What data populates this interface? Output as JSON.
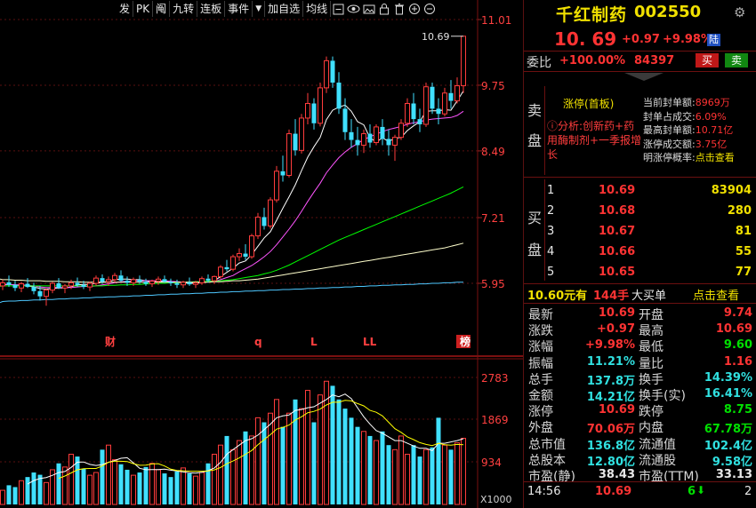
{
  "toolbar": {
    "buttons": [
      "发",
      "PK",
      "阄",
      "九转",
      "连板",
      "事件",
      "▼",
      "加自选",
      "均线"
    ],
    "icons": [
      "minus-box-icon",
      "eye-icon",
      "gallery-icon",
      "lock-icon",
      "trash-icon",
      "zoom-in-icon",
      "zoom-out-icon"
    ]
  },
  "stock": {
    "name": "千红制药",
    "code": "002550",
    "price": "10. 69",
    "change": "+0.97",
    "change_pct": "+9.98%",
    "market_badge": "陆",
    "weibi_label": "委比",
    "weibi_value": "+100.00%",
    "weibi_count": "84397",
    "buy_btn": "买",
    "sell_btn": "卖"
  },
  "limit_panel": {
    "sell_label_1": "卖",
    "sell_label_2": "盘",
    "title": "涨停(首板)",
    "analysis": "ⓘ分析:创新药+药用酶制剂+一季报增长",
    "stats": [
      {
        "k": "当前封单额:",
        "v": "8969万"
      },
      {
        "k": "封单占成交:",
        "v": "6.09%"
      },
      {
        "k": "最高封单额:",
        "v": "10.71亿"
      },
      {
        "k": "涨停成交额:",
        "v": "3.75亿"
      },
      {
        "k": "明涨停概率:",
        "v": "点击查看"
      }
    ]
  },
  "bid": {
    "label_1": "买",
    "label_2": "盘",
    "rows": [
      {
        "level": "1",
        "price": "10.69",
        "vol": "83904"
      },
      {
        "level": "2",
        "price": "10.68",
        "vol": "280"
      },
      {
        "level": "3",
        "price": "10.67",
        "vol": "81"
      },
      {
        "level": "4",
        "price": "10.66",
        "vol": "55"
      },
      {
        "level": "5",
        "price": "10.65",
        "vol": "77"
      }
    ]
  },
  "big_order": {
    "price": "10.60元有",
    "hands": "144手",
    "label": "大买单",
    "link": "点击查看"
  },
  "quote": {
    "rows": [
      {
        "l1": "最新",
        "v1": "10.69",
        "c1": "red",
        "l2": "开盘",
        "v2": "9.74",
        "c2": "red"
      },
      {
        "l1": "涨跌",
        "v1": "+0.97",
        "c1": "red",
        "l2": "最高",
        "v2": "10.69",
        "c2": "red"
      },
      {
        "l1": "涨幅",
        "v1": "+9.98%",
        "c1": "red",
        "l2": "最低",
        "v2": "9.60",
        "c2": "green"
      },
      {
        "l1": "振幅",
        "v1": "11.21%",
        "c1": "cyan",
        "l2": "量比",
        "v2": "1.16",
        "c2": "red"
      },
      {
        "l1": "总手",
        "v1": "137.8万",
        "c1": "cyan",
        "l2": "换手",
        "v2": "14.39%",
        "c2": "cyan"
      },
      {
        "l1": "金额",
        "v1": "14.21亿",
        "c1": "cyan",
        "l2": "换手(实)",
        "v2": "16.41%",
        "c2": "cyan"
      },
      {
        "l1": "涨停",
        "v1": "10.69",
        "c1": "red",
        "l2": "跌停",
        "v2": "8.75",
        "c2": "green"
      },
      {
        "l1": "外盘",
        "v1": "70.06万",
        "c1": "red",
        "l2": "内盘",
        "v2": "67.78万",
        "c2": "green"
      },
      {
        "l1": "总市值",
        "v1": "136.8亿",
        "c1": "cyan",
        "l2": "流通值",
        "v2": "102.4亿",
        "c2": "cyan"
      },
      {
        "l1": "总股本",
        "v1": "12.80亿",
        "c1": "cyan",
        "l2": "流通股",
        "v2": "9.58亿",
        "c2": "cyan"
      },
      {
        "l1": "市盈(静)",
        "v1": "38.43",
        "c1": "white",
        "l2": "市盈(TTM)",
        "v2": "33.13",
        "c2": "white"
      }
    ]
  },
  "last_trade": {
    "time": "14:56",
    "price": "10.69",
    "vol": "6",
    "count": "2"
  },
  "chart_data": {
    "type": "candlestick",
    "price_axis": [
      "11.01",
      "9.75",
      "8.49",
      "7.21",
      "5.95"
    ],
    "price_ticks": [
      11.01,
      9.75,
      8.49,
      7.21,
      5.95
    ],
    "volume_axis": [
      "2783",
      "1869",
      "934"
    ],
    "volume_ticks": [
      2783,
      1869,
      934
    ],
    "volume_unit": "X1000",
    "high_label": "10.69",
    "markers": [
      {
        "text": "财",
        "bar": 17,
        "boxed": false
      },
      {
        "text": "q",
        "bar": 41,
        "boxed": false
      },
      {
        "text": "L",
        "bar": 50,
        "boxed": false
      },
      {
        "text": "LL",
        "bar": 59,
        "boxed": false
      },
      {
        "text": "榜",
        "bar": 74,
        "boxed": true
      }
    ],
    "ohlc": [
      [
        5.9,
        6.02,
        5.82,
        5.96
      ],
      [
        5.97,
        6.1,
        5.88,
        5.92
      ],
      [
        5.92,
        6.0,
        5.8,
        5.86
      ],
      [
        5.86,
        5.98,
        5.78,
        5.94
      ],
      [
        5.94,
        6.05,
        5.86,
        5.88
      ],
      [
        5.88,
        5.96,
        5.74,
        5.8
      ],
      [
        5.8,
        5.9,
        5.62,
        5.7
      ],
      [
        5.7,
        5.85,
        5.52,
        5.82
      ],
      [
        5.82,
        5.98,
        5.76,
        5.95
      ],
      [
        5.95,
        6.05,
        5.84,
        5.86
      ],
      [
        5.86,
        5.94,
        5.76,
        5.9
      ],
      [
        5.9,
        6.02,
        5.84,
        5.96
      ],
      [
        5.96,
        6.06,
        5.88,
        5.92
      ],
      [
        5.92,
        6.0,
        5.84,
        5.88
      ],
      [
        5.88,
        5.98,
        5.8,
        5.95
      ],
      [
        5.95,
        6.1,
        5.9,
        6.05
      ],
      [
        6.05,
        6.12,
        5.94,
        5.98
      ],
      [
        5.98,
        6.08,
        5.9,
        6.02
      ],
      [
        6.02,
        6.15,
        5.96,
        6.1
      ],
      [
        6.1,
        6.2,
        5.98,
        6.0
      ],
      [
        6.0,
        6.08,
        5.9,
        5.96
      ],
      [
        5.96,
        6.06,
        5.9,
        6.02
      ],
      [
        6.02,
        6.1,
        5.94,
        5.98
      ],
      [
        5.98,
        6.04,
        5.9,
        5.94
      ],
      [
        5.94,
        6.02,
        5.88,
        5.99
      ],
      [
        5.99,
        6.08,
        5.92,
        6.03
      ],
      [
        6.03,
        6.1,
        5.96,
        5.98
      ],
      [
        5.98,
        6.04,
        5.9,
        5.95
      ],
      [
        5.95,
        6.02,
        5.86,
        5.92
      ],
      [
        5.92,
        6.0,
        5.86,
        5.97
      ],
      [
        5.97,
        6.06,
        5.9,
        5.93
      ],
      [
        5.93,
        6.0,
        5.86,
        5.96
      ],
      [
        5.96,
        6.08,
        5.92,
        6.04
      ],
      [
        6.04,
        6.12,
        5.96,
        6.0
      ],
      [
        6.0,
        6.1,
        5.94,
        6.08
      ],
      [
        6.08,
        6.3,
        6.04,
        6.26
      ],
      [
        6.26,
        6.4,
        6.18,
        6.22
      ],
      [
        6.22,
        6.5,
        6.18,
        6.46
      ],
      [
        6.46,
        6.62,
        6.38,
        6.52
      ],
      [
        6.52,
        6.7,
        6.4,
        6.46
      ],
      [
        6.46,
        6.9,
        6.42,
        6.86
      ],
      [
        6.86,
        7.3,
        6.8,
        7.22
      ],
      [
        7.22,
        7.4,
        6.98,
        7.05
      ],
      [
        7.05,
        7.6,
        7.0,
        7.55
      ],
      [
        7.55,
        8.2,
        7.5,
        8.1
      ],
      [
        8.1,
        8.4,
        7.9,
        8.02
      ],
      [
        8.02,
        8.9,
        7.98,
        8.82
      ],
      [
        8.82,
        9.1,
        8.4,
        8.5
      ],
      [
        8.5,
        9.2,
        8.44,
        9.12
      ],
      [
        9.12,
        9.6,
        9.0,
        9.4
      ],
      [
        9.4,
        9.5,
        8.9,
        9.02
      ],
      [
        9.02,
        9.8,
        8.96,
        9.7
      ],
      [
        9.7,
        10.3,
        9.6,
        10.22
      ],
      [
        10.22,
        10.3,
        9.7,
        9.8
      ],
      [
        9.8,
        10.0,
        9.2,
        9.3
      ],
      [
        9.3,
        9.5,
        8.7,
        8.85
      ],
      [
        8.85,
        9.1,
        8.55,
        8.7
      ],
      [
        8.7,
        8.95,
        8.4,
        8.6
      ],
      [
        8.6,
        8.9,
        8.45,
        8.82
      ],
      [
        8.82,
        9.0,
        8.55,
        8.65
      ],
      [
        8.65,
        9.0,
        8.6,
        8.95
      ],
      [
        8.95,
        9.1,
        8.6,
        8.72
      ],
      [
        8.72,
        8.9,
        8.4,
        8.6
      ],
      [
        8.6,
        8.8,
        8.3,
        8.75
      ],
      [
        8.75,
        9.1,
        8.7,
        9.02
      ],
      [
        9.02,
        9.5,
        8.95,
        9.4
      ],
      [
        9.4,
        9.6,
        9.0,
        9.1
      ],
      [
        9.1,
        9.3,
        8.85,
        9.0
      ],
      [
        9.0,
        9.8,
        8.95,
        9.72
      ],
      [
        9.72,
        9.8,
        9.2,
        9.3
      ],
      [
        9.3,
        9.5,
        9.0,
        9.2
      ],
      [
        9.2,
        9.7,
        9.15,
        9.6
      ],
      [
        9.6,
        9.85,
        9.3,
        9.45
      ],
      [
        9.45,
        9.9,
        9.4,
        9.74
      ],
      [
        9.74,
        10.69,
        9.6,
        10.69
      ]
    ],
    "volume": [
      310,
      420,
      380,
      520,
      600,
      700,
      650,
      480,
      760,
      900,
      820,
      1100,
      1050,
      780,
      640,
      700,
      1200,
      1300,
      980,
      880,
      760,
      640,
      700,
      820,
      900,
      760,
      680,
      600,
      720,
      800,
      680,
      620,
      700,
      900,
      1100,
      1300,
      1500,
      1200,
      1400,
      1600,
      1500,
      1900,
      1800,
      2000,
      2300,
      1700,
      2000,
      2300,
      2100,
      2500,
      1800,
      2400,
      2700,
      2600,
      2300,
      2100,
      1900,
      1700,
      1600,
      1500,
      1400,
      1600,
      1300,
      1200,
      1500,
      1100,
      1300,
      1050,
      1200,
      1250,
      1900,
      1300,
      1200,
      1350,
      1450
    ],
    "ma_price": [
      {
        "color": "#ffffff",
        "values_from": 0,
        "data": [
          5.92,
          5.93,
          5.92,
          5.91,
          5.9,
          5.88,
          5.85,
          5.84,
          5.85,
          5.86,
          5.86,
          5.88,
          5.92,
          5.93,
          5.93,
          5.95,
          5.97,
          5.98,
          6.02,
          6.03,
          6.03,
          6.02,
          6.02,
          6.0,
          5.98,
          5.98,
          5.99,
          5.99,
          5.97,
          5.96,
          5.95,
          5.95,
          5.96,
          5.98,
          6.0,
          6.08,
          6.16,
          6.24,
          6.34,
          6.38,
          6.5,
          6.66,
          6.82,
          6.94,
          7.16,
          7.39,
          7.61,
          7.84,
          8.11,
          8.37,
          8.57,
          8.75,
          9.09,
          9.27,
          9.33,
          9.37,
          9.25,
          9.05,
          8.99,
          8.74,
          8.66,
          8.74,
          8.67,
          8.73,
          8.75,
          8.88,
          8.97,
          9.05,
          9.25,
          9.26,
          9.26,
          9.28,
          9.27,
          9.45,
          9.64
        ]
      },
      {
        "color": "#ff55ff",
        "values_from": 0,
        "data": [
          5.93,
          5.93,
          5.92,
          5.92,
          5.91,
          5.9,
          5.88,
          5.87,
          5.87,
          5.87,
          5.87,
          5.87,
          5.88,
          5.89,
          5.89,
          5.9,
          5.92,
          5.94,
          5.96,
          5.98,
          5.99,
          6.0,
          6.0,
          6.0,
          6.0,
          6.0,
          6.0,
          5.99,
          5.98,
          5.97,
          5.97,
          5.97,
          5.97,
          5.98,
          5.99,
          6.02,
          6.06,
          6.1,
          6.17,
          6.23,
          6.29,
          6.37,
          6.46,
          6.56,
          6.69,
          6.84,
          6.99,
          7.15,
          7.33,
          7.52,
          7.7,
          7.87,
          8.07,
          8.22,
          8.36,
          8.47,
          8.56,
          8.63,
          8.71,
          8.76,
          8.81,
          8.86,
          8.9,
          8.93,
          8.96,
          9.0,
          9.03,
          9.05,
          9.08,
          9.1,
          9.11,
          9.12,
          9.13,
          9.17,
          9.25
        ]
      },
      {
        "color": "#00ff00",
        "values_from": 0,
        "data": [
          5.9,
          5.9,
          5.9,
          5.9,
          5.9,
          5.9,
          5.9,
          5.9,
          5.9,
          5.9,
          5.9,
          5.9,
          5.9,
          5.9,
          5.9,
          5.9,
          5.9,
          5.91,
          5.91,
          5.92,
          5.92,
          5.93,
          5.93,
          5.94,
          5.94,
          5.95,
          5.95,
          5.96,
          5.96,
          5.97,
          5.97,
          5.98,
          5.98,
          5.99,
          5.99,
          6.0,
          6.01,
          6.02,
          6.04,
          6.06,
          6.08,
          6.1,
          6.13,
          6.16,
          6.2,
          6.25,
          6.3,
          6.36,
          6.42,
          6.48,
          6.54,
          6.6,
          6.66,
          6.72,
          6.78,
          6.83,
          6.88,
          6.93,
          6.98,
          7.03,
          7.08,
          7.13,
          7.18,
          7.23,
          7.28,
          7.33,
          7.38,
          7.43,
          7.48,
          7.53,
          7.58,
          7.63,
          7.68,
          7.74,
          7.8
        ]
      },
      {
        "color": "#ffffcc",
        "values_from": 0,
        "data": [
          6.02,
          6.02,
          6.01,
          6.01,
          6.0,
          6.0,
          6.0,
          5.99,
          5.99,
          5.99,
          5.98,
          5.98,
          5.98,
          5.97,
          5.97,
          5.97,
          5.97,
          5.97,
          5.97,
          5.97,
          5.97,
          5.97,
          5.97,
          5.97,
          5.97,
          5.97,
          5.97,
          5.97,
          5.97,
          5.97,
          5.97,
          5.97,
          5.97,
          5.97,
          5.98,
          5.98,
          5.99,
          6.0,
          6.0,
          6.01,
          6.02,
          6.03,
          6.05,
          6.07,
          6.09,
          6.11,
          6.13,
          6.15,
          6.17,
          6.19,
          6.21,
          6.23,
          6.25,
          6.27,
          6.29,
          6.31,
          6.33,
          6.35,
          6.37,
          6.39,
          6.41,
          6.43,
          6.45,
          6.47,
          6.49,
          6.51,
          6.53,
          6.55,
          6.57,
          6.59,
          6.61,
          6.63,
          6.66,
          6.69,
          6.72
        ]
      },
      {
        "color": "#4ec8ff",
        "values_from": 0,
        "data": [
          5.6,
          5.61,
          5.61,
          5.62,
          5.62,
          5.63,
          5.63,
          5.64,
          5.64,
          5.65,
          5.65,
          5.66,
          5.66,
          5.67,
          5.67,
          5.68,
          5.68,
          5.69,
          5.69,
          5.7,
          5.7,
          5.71,
          5.71,
          5.72,
          5.72,
          5.73,
          5.73,
          5.74,
          5.74,
          5.75,
          5.75,
          5.76,
          5.76,
          5.77,
          5.77,
          5.78,
          5.78,
          5.79,
          5.79,
          5.8,
          5.8,
          5.81,
          5.81,
          5.82,
          5.82,
          5.83,
          5.83,
          5.84,
          5.84,
          5.85,
          5.85,
          5.86,
          5.86,
          5.87,
          5.87,
          5.88,
          5.88,
          5.89,
          5.89,
          5.9,
          5.9,
          5.91,
          5.91,
          5.92,
          5.92,
          5.93,
          5.93,
          5.94,
          5.94,
          5.95,
          5.95,
          5.96,
          5.96,
          5.97,
          5.97
        ]
      }
    ],
    "ma_volume": [
      {
        "color": "#ffffff"
      },
      {
        "color": "#ffff00"
      }
    ]
  }
}
